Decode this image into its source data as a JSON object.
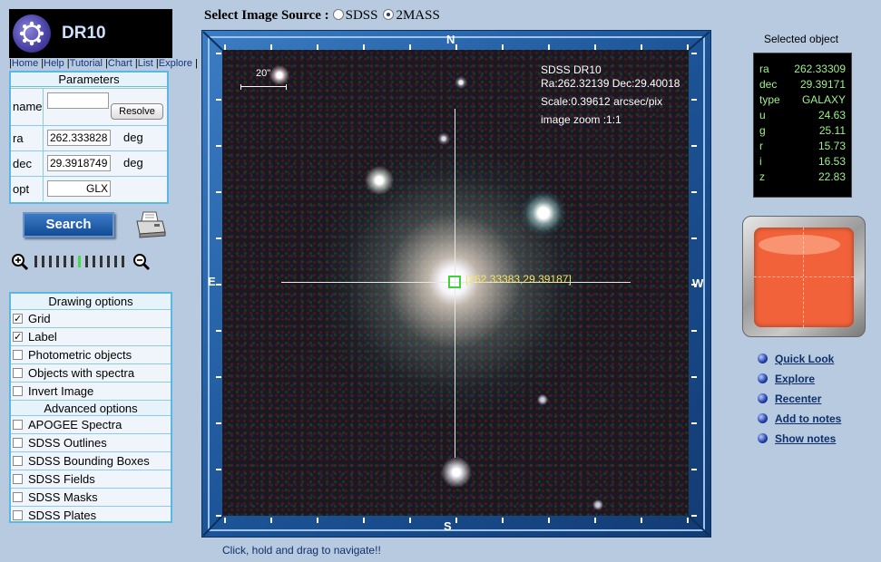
{
  "app": {
    "title": "DR10"
  },
  "nav": {
    "links": [
      "Home",
      "Help",
      "Tutorial",
      "Chart",
      "List",
      "Explore"
    ]
  },
  "params": {
    "header": "Parameters",
    "name_label": "name",
    "name_value": "",
    "resolve_label": "Resolve",
    "ra_label": "ra",
    "ra_value": "262.333828",
    "ra_unit": "deg",
    "dec_label": "dec",
    "dec_value": "29.3918749",
    "dec_unit": "deg",
    "opt_label": "opt",
    "opt_value": "GLX"
  },
  "search": {
    "label": "Search"
  },
  "icons": {
    "logo": "sdss-logo-icon",
    "printer": "printer-icon",
    "zoom_in": "zoom-in-icon",
    "zoom_out": "zoom-out-icon",
    "link_bullet": "blue-bullet-icon"
  },
  "zoom": {
    "level_index": 6,
    "level_count": 13
  },
  "drawing": {
    "header": "Drawing options",
    "items": [
      {
        "label": "Grid",
        "checked": true
      },
      {
        "label": "Label",
        "checked": true
      },
      {
        "label": "Photometric objects",
        "checked": false
      },
      {
        "label": "Objects with spectra",
        "checked": false
      },
      {
        "label": "Invert Image",
        "checked": false
      }
    ],
    "advanced_header": "Advanced options",
    "advanced_items": [
      {
        "label": "APOGEE Spectra",
        "checked": false
      },
      {
        "label": "SDSS Outlines",
        "checked": false
      },
      {
        "label": "SDSS Bounding Boxes",
        "checked": false
      },
      {
        "label": "SDSS Fields",
        "checked": false
      },
      {
        "label": "SDSS Masks",
        "checked": false
      },
      {
        "label": "SDSS Plates",
        "checked": false
      }
    ]
  },
  "source": {
    "title": "Select Image Source :",
    "options": [
      "SDSS",
      "2MASS"
    ],
    "selected": "2MASS"
  },
  "viewer": {
    "compass": {
      "north": "N",
      "south": "S",
      "east": "E",
      "west": "W"
    },
    "scalebar": "20\"",
    "info_line1": "SDSS DR10",
    "info_line2": "Ra:262.32139  Dec:29.40018",
    "info_line3": "Scale:0.39612 arcsec/pix",
    "info_line4": "image zoom :1:1",
    "marker_label": "[262.33383,29.39187]",
    "hint": "Click, hold and drag to navigate!!"
  },
  "selected": {
    "title": "Selected object",
    "rows": [
      {
        "key": "ra",
        "value": "262.33309"
      },
      {
        "key": "dec",
        "value": "29.39171"
      },
      {
        "key": "type",
        "value": "GALAXY"
      },
      {
        "key": "u",
        "value": "24.63"
      },
      {
        "key": "g",
        "value": "25.11"
      },
      {
        "key": "r",
        "value": "15.73"
      },
      {
        "key": "i",
        "value": "16.53"
      },
      {
        "key": "z",
        "value": "22.83"
      }
    ]
  },
  "actions": [
    "Quick Look",
    "Explore",
    "Recenter",
    "Add to notes",
    "Show notes"
  ],
  "colors": {
    "background": "#b7cae0",
    "frame": "#1e5a9e",
    "panel_border": "#5bb7e3",
    "selected_text": "#9ff28a",
    "marker": "#3fd23f",
    "thumbnail": "#f2623a"
  }
}
